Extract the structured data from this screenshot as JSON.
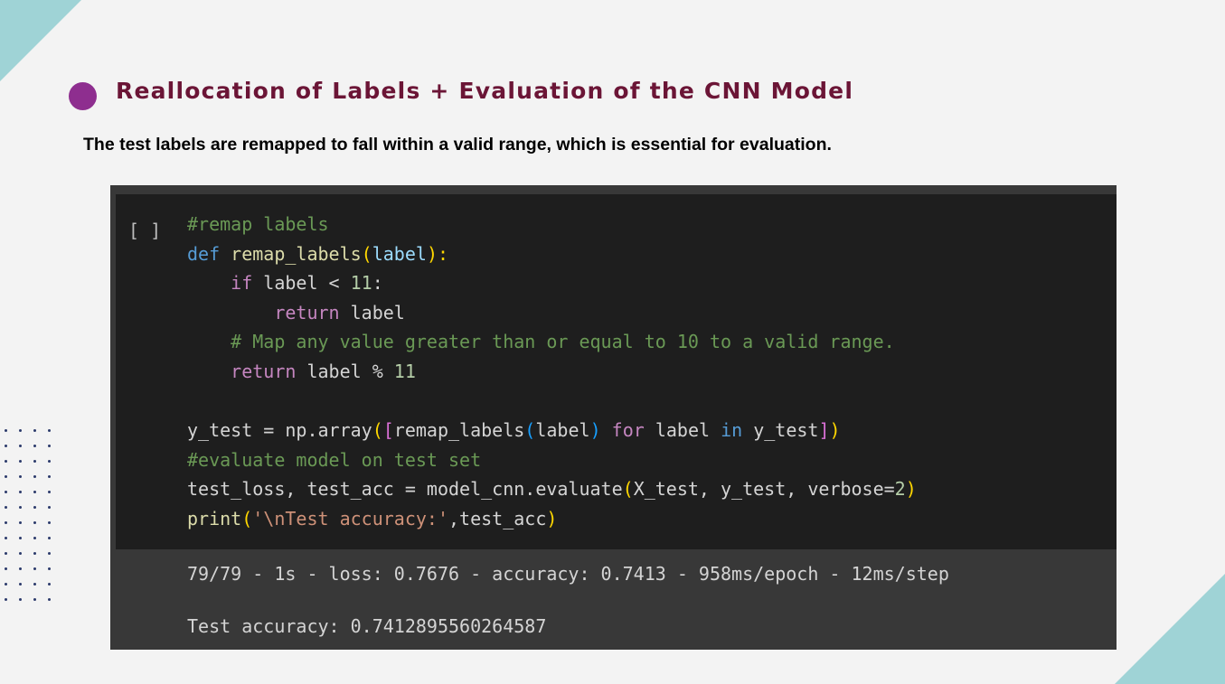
{
  "colors": {
    "background": "#f3f3f3",
    "accent_teal": "#9fd3d6",
    "bullet_purple": "#8e2e8f",
    "title": "#6b1536",
    "code_bg": "#1e1e1e",
    "output_bg": "#383838",
    "token_comment": "#6a9955",
    "token_keyword": "#569cd6",
    "token_control": "#c586c0",
    "token_function": "#dcdcaa",
    "token_variable": "#9cdcfe",
    "token_number": "#b5cea8",
    "token_string": "#ce9178",
    "token_bracket1": "#ffd700",
    "token_bracket2": "#da70d6",
    "token_bracket3": "#179fff",
    "token_default": "#d4d4d4"
  },
  "slide": {
    "title": "Reallocation of Labels + Evaluation of the CNN Model",
    "subtitle": "The test labels are remapped to fall within a valid range, which is essential for evaluation."
  },
  "cell": {
    "run_button": "[ ]",
    "lines": [
      [
        [
          "#remap labels",
          "comment"
        ]
      ],
      [
        [
          "def ",
          "keyword"
        ],
        [
          "remap_labels",
          "function"
        ],
        [
          "(",
          "bracket1"
        ],
        [
          "label",
          "variable"
        ],
        [
          "):",
          "bracket1"
        ]
      ],
      [
        [
          "    ",
          "default"
        ],
        [
          "if",
          "control"
        ],
        [
          " label < ",
          "default"
        ],
        [
          "11",
          "number"
        ],
        [
          ":",
          "default"
        ]
      ],
      [
        [
          "        ",
          "default"
        ],
        [
          "return",
          "control"
        ],
        [
          " label",
          "default"
        ]
      ],
      [
        [
          "    # Map any value greater than or equal to 10 to a valid range.",
          "comment"
        ]
      ],
      [
        [
          "    ",
          "default"
        ],
        [
          "return",
          "control"
        ],
        [
          " label % ",
          "default"
        ],
        [
          "11",
          "number"
        ]
      ],
      [],
      [
        [
          "y_test = np.array",
          "default"
        ],
        [
          "(",
          "bracket1"
        ],
        [
          "[",
          "bracket2"
        ],
        [
          "remap_labels",
          "default"
        ],
        [
          "(",
          "bracket3"
        ],
        [
          "label",
          "default"
        ],
        [
          ")",
          "bracket3"
        ],
        [
          " ",
          "default"
        ],
        [
          "for",
          "control"
        ],
        [
          " label ",
          "default"
        ],
        [
          "in",
          "keyword"
        ],
        [
          " y_test",
          "default"
        ],
        [
          "]",
          "bracket2"
        ],
        [
          ")",
          "bracket1"
        ]
      ],
      [
        [
          "#evaluate model on test set",
          "comment"
        ]
      ],
      [
        [
          "test_loss, test_acc = model_cnn.evaluate",
          "default"
        ],
        [
          "(",
          "bracket1"
        ],
        [
          "X_test, y_test, verbose=",
          "default"
        ],
        [
          "2",
          "number"
        ],
        [
          ")",
          "bracket1"
        ]
      ],
      [
        [
          "print",
          "function"
        ],
        [
          "(",
          "bracket1"
        ],
        [
          "'\\nTest accuracy:'",
          "string"
        ],
        [
          ",test_acc",
          "default"
        ],
        [
          ")",
          "bracket1"
        ]
      ]
    ]
  },
  "output": {
    "lines": [
      "79/79 - 1s - loss: 0.7676 - accuracy: 0.7413 - 958ms/epoch - 12ms/step",
      "",
      "Test accuracy: 0.7412895560264587"
    ]
  }
}
